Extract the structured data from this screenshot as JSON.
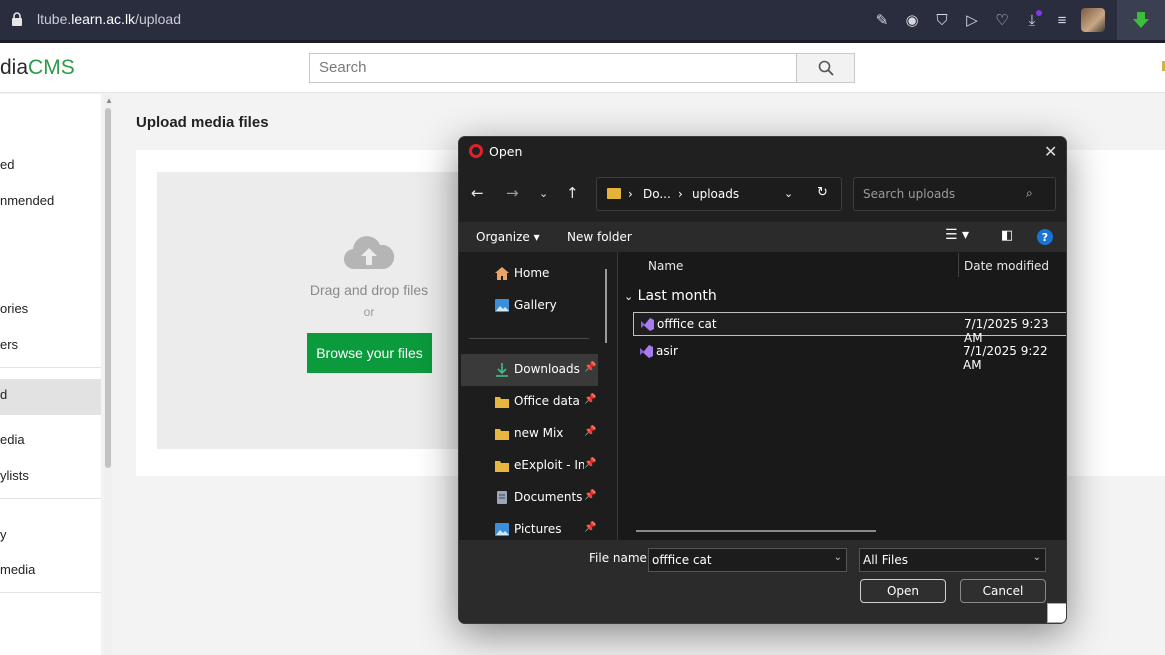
{
  "browser": {
    "url_prefix": "ltube.",
    "url_domain": "learn.ac.lk",
    "url_path": "/upload"
  },
  "site": {
    "logo_prefix": "dia",
    "logo_suffix": "CMS",
    "search_placeholder": "Search"
  },
  "sidebar": {
    "items": [
      "ed",
      "nmended",
      "ories",
      "ers",
      "d",
      "edia",
      "ylists",
      "y",
      "media"
    ]
  },
  "main": {
    "title": "Upload media files",
    "drag_text": "Drag and drop files",
    "or_text": "or",
    "browse_label": "Browse your files"
  },
  "dialog": {
    "title": "Open",
    "breadcrumb": [
      "Do...",
      "uploads"
    ],
    "search_placeholder": "Search uploads",
    "organize": "Organize",
    "new_folder": "New folder",
    "nav_items": [
      "Home",
      "Gallery",
      "Downloads",
      "Office data",
      "new Mix",
      "eExploit - Intu",
      "Documents",
      "Pictures"
    ],
    "columns": {
      "name": "Name",
      "date": "Date modified"
    },
    "group_label": "Last month",
    "files": [
      {
        "name": "offfice cat",
        "date": "7/1/2025 9:23 AM"
      },
      {
        "name": "asir",
        "date": "7/1/2025 9:22 AM"
      }
    ],
    "file_name_label": "File name:",
    "file_name_value": "offfice cat",
    "file_type": "All Files",
    "open_label": "Open",
    "cancel_label": "Cancel"
  },
  "colors": {
    "accent_green": "#0b9a3c",
    "browser_bar": "#2a2d3e",
    "dialog_bg": "#202020"
  }
}
